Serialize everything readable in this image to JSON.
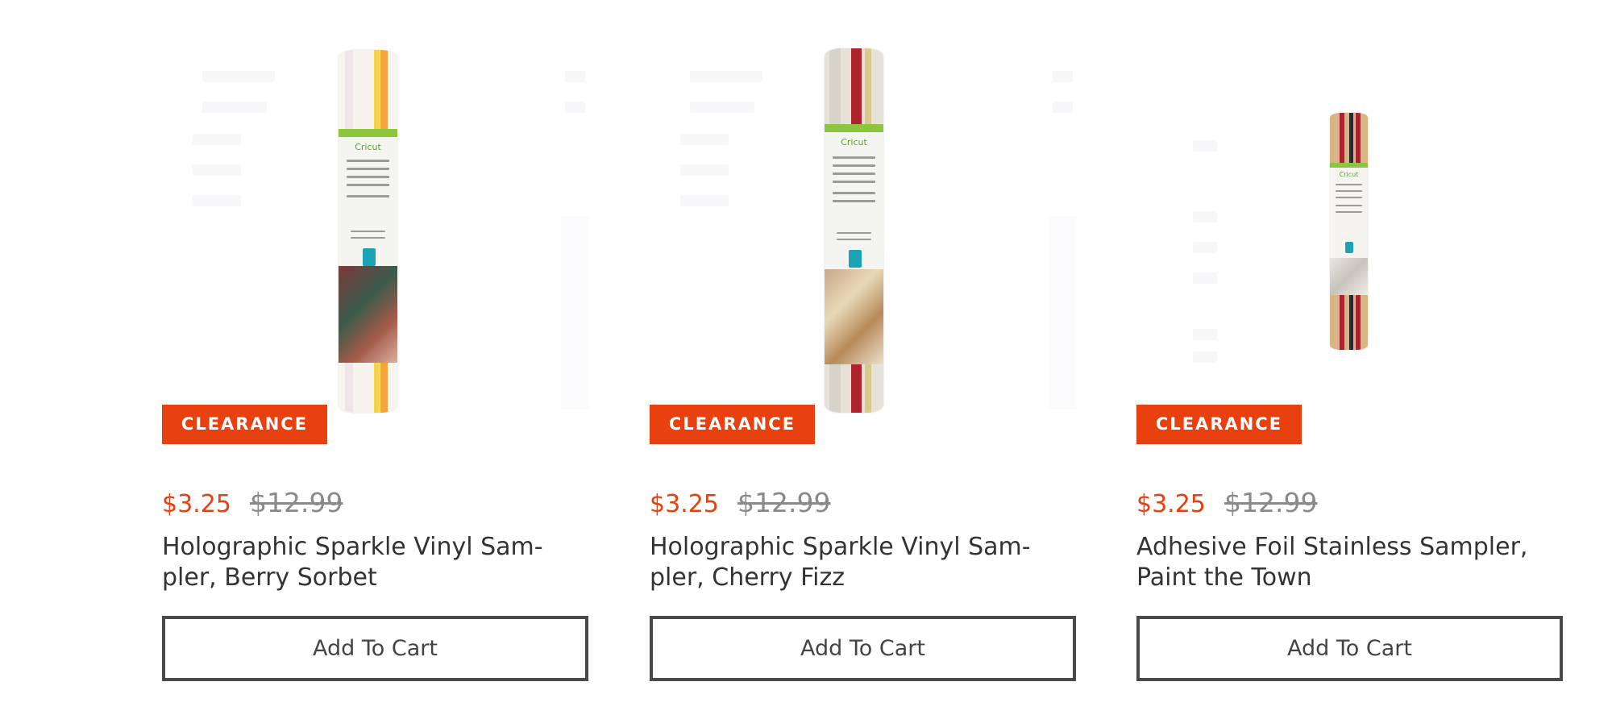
{
  "products": [
    {
      "badge": "CLEARANCE",
      "sale_price": "$3.25",
      "original_price": "$12.99",
      "title": "Holographic Sparkle Vinyl Sam-\npler, Berry Sorbet",
      "button_label": "Add To Cart",
      "image_logo": "Cricut",
      "accent_colors": [
        "#f2a33a",
        "#f7d24a",
        "#e9c7c1"
      ]
    },
    {
      "badge": "CLEARANCE",
      "sale_price": "$3.25",
      "original_price": "$12.99",
      "title": "Holographic Sparkle Vinyl Sam-\npler, Cherry Fizz",
      "button_label": "Add To Cart",
      "image_logo": "Cricut",
      "accent_colors": [
        "#b0222c",
        "#d9c98a",
        "#c9c4b6"
      ]
    },
    {
      "badge": "CLEARANCE",
      "sale_price": "$3.25",
      "original_price": "$12.99",
      "title": "Adhesive Foil Stainless Sampler,\nPaint the Town",
      "button_label": "Add To Cart",
      "image_logo": "Cricut",
      "accent_colors": [
        "#b02030",
        "#d6b27a",
        "#2a2a2a"
      ]
    }
  ],
  "colors": {
    "badge_bg": "#e8400f",
    "sale_price": "#e8400f",
    "original_price": "#8a8a8a",
    "button_border": "#4a4a4a"
  }
}
